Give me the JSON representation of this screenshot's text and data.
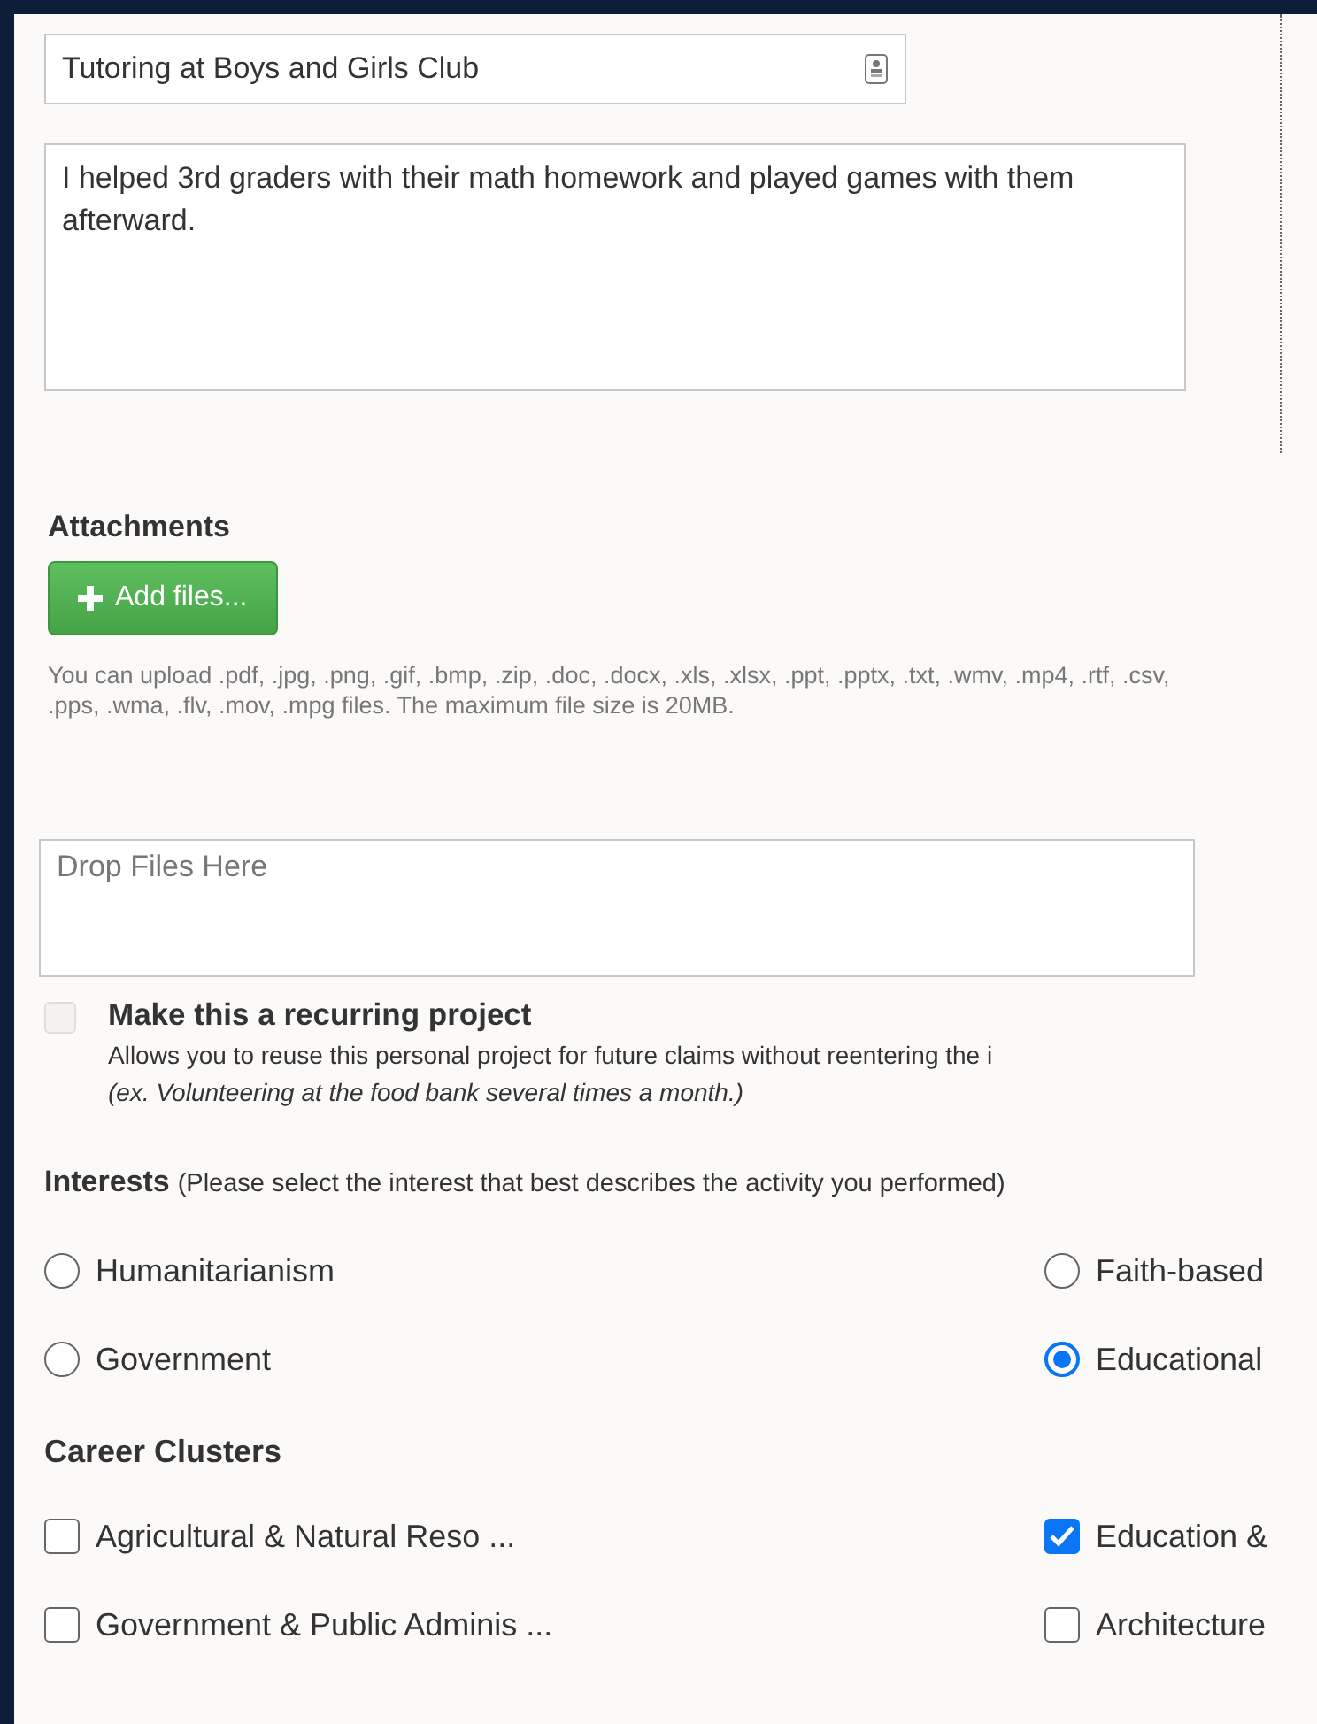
{
  "title_field": {
    "value": "Tutoring at Boys and Girls Club"
  },
  "description_field": {
    "value": "I helped 3rd graders with their math homework and played games with them afterward."
  },
  "attachments": {
    "heading": "Attachments",
    "add_button": "Add files...",
    "help": "You can upload .pdf, .jpg, .png, .gif, .bmp, .zip, .doc, .docx, .xls, .xlsx, .ppt, .pptx, .txt, .wmv, .mp4, .rtf, .csv, .pps, .wma, .flv, .mov, .mpg files. The maximum file size is 20MB.",
    "drop_zone": "Drop Files Here"
  },
  "recurring": {
    "label": "Make this a recurring project",
    "checked": false,
    "disabled": true,
    "description": "Allows you to reuse this personal project for future claims without reentering the i",
    "example": "(ex. Volunteering at the food bank several times a month.)"
  },
  "interests": {
    "heading": "Interests",
    "note": "(Please select the interest that best describes the activity you performed)",
    "options": [
      {
        "label": "Humanitarianism",
        "selected": false
      },
      {
        "label": "Faith-based",
        "selected": false
      },
      {
        "label": "Government",
        "selected": false
      },
      {
        "label": "Educational",
        "selected": true
      }
    ]
  },
  "career_clusters": {
    "heading": "Career Clusters",
    "options": [
      {
        "label": "Agricultural & Natural Reso ...",
        "checked": false
      },
      {
        "label": "Education &",
        "checked": true
      },
      {
        "label": "Government & Public Adminis ...",
        "checked": false
      },
      {
        "label": "Architecture",
        "checked": false
      }
    ]
  }
}
